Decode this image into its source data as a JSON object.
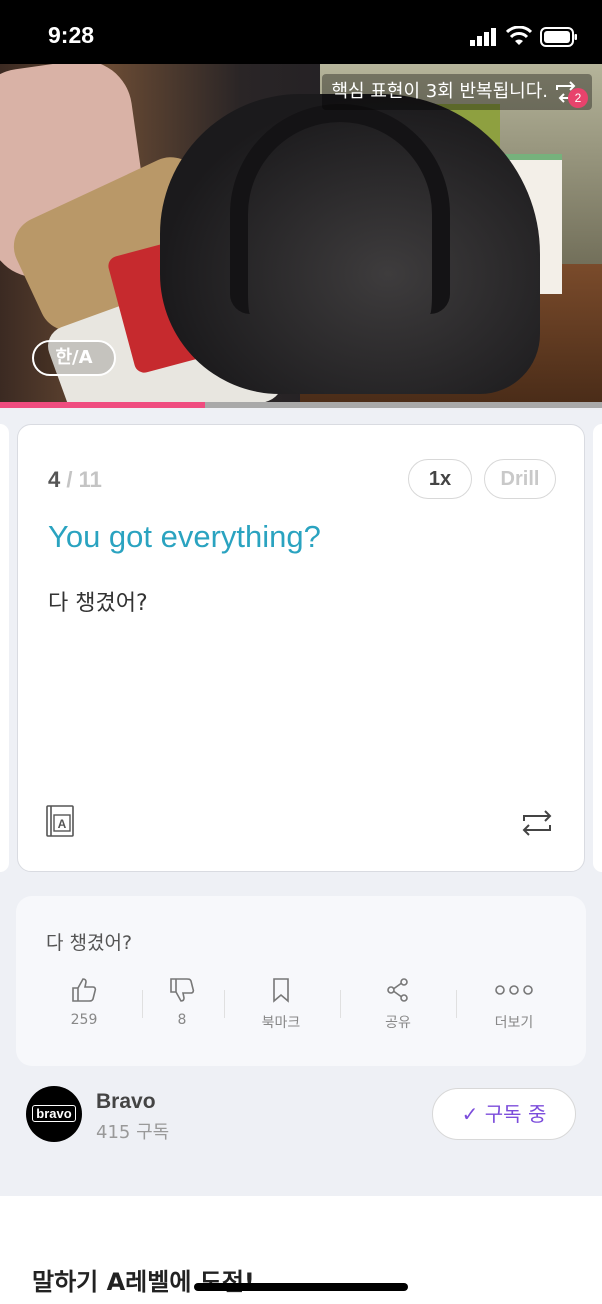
{
  "status_bar": {
    "time": "9:28"
  },
  "video": {
    "caption": "핵심 표현이 3회 반복됩니다.",
    "repeat_badge": "2",
    "lang_toggle": "한/A",
    "progress": 0.34
  },
  "card": {
    "current": "4",
    "total": "/ 11",
    "speed_label": "1x",
    "drill_label": "Drill",
    "english": "You got everything?",
    "korean": "다 챙겼어?"
  },
  "info": {
    "sentence": "다 챙겼어?",
    "actions": {
      "like": "259",
      "dislike": "8",
      "bookmark": "북마크",
      "share": "공유",
      "more": "더보기"
    }
  },
  "channel": {
    "logo_text": "bravo",
    "name": "Bravo",
    "subscribers": "415 구독",
    "subscribe_label": "구독 중"
  },
  "bottom": {
    "title": "말하기 A레벨에 도전!"
  },
  "colors": {
    "accent_blue": "#2aa3c0",
    "progress_pink": "#ef4c7f",
    "subscribe_purple": "#7c4ddb"
  }
}
